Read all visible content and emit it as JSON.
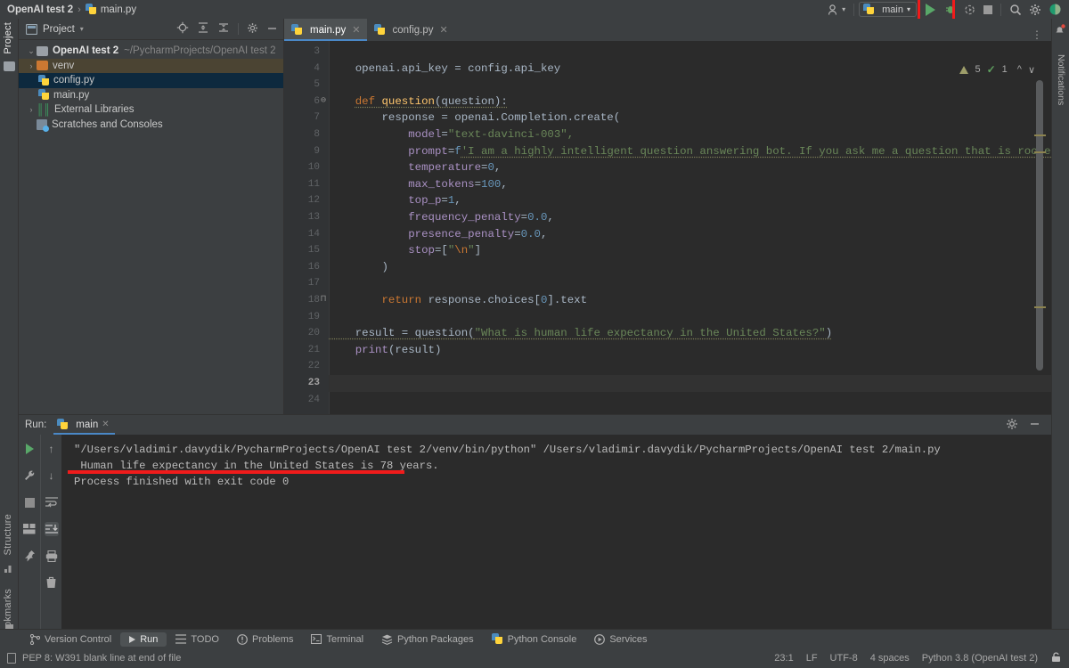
{
  "titlebar": {
    "project_name": "OpenAI test 2",
    "separator": "›",
    "file_name": "main.py"
  },
  "toolbar": {
    "run_config": "main",
    "run_label": "Run",
    "debug_label": "Debug",
    "coverage_label": "Run with Coverage",
    "stop_label": "Stop",
    "search_label": "Search Everywhere",
    "settings_label": "Settings",
    "account_label": "Account",
    "highlight_color": "#f01b1b",
    "run_icon_color": "#59a869"
  },
  "left_strip": {
    "project_tab": "Project",
    "structure_tab": "Structure",
    "bookmarks_tab": "Bookmarks"
  },
  "right_strip": {
    "notifications_tab": "Notifications"
  },
  "project_panel": {
    "title": "Project",
    "tree": [
      {
        "label": "OpenAI test 2",
        "path": "~/PycharmProjects/OpenAI test 2",
        "indent": 0,
        "arrow": "⌄",
        "icon": "folder",
        "bold": true,
        "state": "normal"
      },
      {
        "label": "venv",
        "path": "",
        "indent": 1,
        "arrow": "›",
        "icon": "folder-orange",
        "bold": false,
        "state": "venv"
      },
      {
        "label": "config.py",
        "path": "",
        "indent": 2,
        "arrow": "",
        "icon": "python-file",
        "bold": false,
        "state": "selected"
      },
      {
        "label": "main.py",
        "path": "",
        "indent": 2,
        "arrow": "",
        "icon": "python-file",
        "bold": false,
        "state": "normal"
      },
      {
        "label": "External Libraries",
        "path": "",
        "indent": 0,
        "arrow": "›",
        "icon": "library",
        "bold": false,
        "state": "normal"
      },
      {
        "label": "Scratches and Consoles",
        "path": "",
        "indent": 1,
        "arrow": "",
        "icon": "scratch",
        "bold": false,
        "state": "normal"
      }
    ]
  },
  "editor": {
    "tabs": [
      {
        "label": "main.py",
        "active": true
      },
      {
        "label": "config.py",
        "active": false
      }
    ],
    "inspection": {
      "warning_count": "5",
      "check_count": "1"
    },
    "first_visible_line": 3,
    "current_line": 23,
    "lines": [
      {
        "n": 3,
        "tokens": []
      },
      {
        "n": 4,
        "tokens": [
          {
            "t": "    openai.api_key = config.api_key",
            "c": "dflt"
          }
        ]
      },
      {
        "n": 5,
        "tokens": []
      },
      {
        "n": 6,
        "fold": "⊖",
        "tokens": [
          {
            "t": "    ",
            "c": "dflt"
          },
          {
            "t": "def ",
            "c": "kw wavy"
          },
          {
            "t": "question",
            "c": "fn wavy"
          },
          {
            "t": "(question):",
            "c": "dflt wavy"
          }
        ]
      },
      {
        "n": 7,
        "tokens": [
          {
            "t": "        response = openai.Completion.create(",
            "c": "dflt"
          }
        ]
      },
      {
        "n": 8,
        "tokens": [
          {
            "t": "            ",
            "c": "dflt"
          },
          {
            "t": "model",
            "c": "par"
          },
          {
            "t": "=",
            "c": "dflt"
          },
          {
            "t": "\"text-davinci-003\",",
            "c": "str"
          }
        ]
      },
      {
        "n": 9,
        "tokens": [
          {
            "t": "            ",
            "c": "dflt"
          },
          {
            "t": "prompt",
            "c": "par"
          },
          {
            "t": "=",
            "c": "dflt"
          },
          {
            "t": "f",
            "c": "num"
          },
          {
            "t": "'I am a highly intelligent question answering bot. If you ask me a question that is rooted in truth, I wil",
            "c": "str wavy"
          }
        ]
      },
      {
        "n": 10,
        "tokens": [
          {
            "t": "            ",
            "c": "dflt"
          },
          {
            "t": "temperature",
            "c": "par"
          },
          {
            "t": "=",
            "c": "dflt"
          },
          {
            "t": "0",
            "c": "num"
          },
          {
            "t": ",",
            "c": "dflt"
          }
        ]
      },
      {
        "n": 11,
        "tokens": [
          {
            "t": "            ",
            "c": "dflt"
          },
          {
            "t": "max_tokens",
            "c": "par"
          },
          {
            "t": "=",
            "c": "dflt"
          },
          {
            "t": "100",
            "c": "num"
          },
          {
            "t": ",",
            "c": "dflt"
          }
        ]
      },
      {
        "n": 12,
        "tokens": [
          {
            "t": "            ",
            "c": "dflt"
          },
          {
            "t": "top_p",
            "c": "par"
          },
          {
            "t": "=",
            "c": "dflt"
          },
          {
            "t": "1",
            "c": "num"
          },
          {
            "t": ",",
            "c": "dflt"
          }
        ]
      },
      {
        "n": 13,
        "tokens": [
          {
            "t": "            ",
            "c": "dflt"
          },
          {
            "t": "frequency_penalty",
            "c": "par"
          },
          {
            "t": "=",
            "c": "dflt"
          },
          {
            "t": "0.0",
            "c": "num"
          },
          {
            "t": ",",
            "c": "dflt"
          }
        ]
      },
      {
        "n": 14,
        "tokens": [
          {
            "t": "            ",
            "c": "dflt"
          },
          {
            "t": "presence_penalty",
            "c": "par"
          },
          {
            "t": "=",
            "c": "dflt"
          },
          {
            "t": "0.0",
            "c": "num"
          },
          {
            "t": ",",
            "c": "dflt"
          }
        ]
      },
      {
        "n": 15,
        "tokens": [
          {
            "t": "            ",
            "c": "dflt"
          },
          {
            "t": "stop",
            "c": "par"
          },
          {
            "t": "=[",
            "c": "dflt"
          },
          {
            "t": "\"",
            "c": "str"
          },
          {
            "t": "\\n",
            "c": "kw"
          },
          {
            "t": "\"",
            "c": "str"
          },
          {
            "t": "]",
            "c": "dflt"
          }
        ]
      },
      {
        "n": 16,
        "tokens": [
          {
            "t": "        )",
            "c": "dflt"
          }
        ]
      },
      {
        "n": 17,
        "tokens": []
      },
      {
        "n": 18,
        "fold": "⊓",
        "tokens": [
          {
            "t": "        ",
            "c": "dflt"
          },
          {
            "t": "return ",
            "c": "kw"
          },
          {
            "t": "response.choices[",
            "c": "dflt"
          },
          {
            "t": "0",
            "c": "num"
          },
          {
            "t": "].text",
            "c": "dflt"
          }
        ]
      },
      {
        "n": 19,
        "tokens": []
      },
      {
        "n": 20,
        "tokens": [
          {
            "t": "    result = ",
            "c": "dflt wavy"
          },
          {
            "t": "question",
            "c": "dflt wavy"
          },
          {
            "t": "(",
            "c": "dflt wavy"
          },
          {
            "t": "\"What is human life expectancy in the United States?\"",
            "c": "str wavy"
          },
          {
            "t": ")",
            "c": "dflt wavy"
          }
        ]
      },
      {
        "n": 21,
        "tokens": [
          {
            "t": "    ",
            "c": "dflt"
          },
          {
            "t": "print",
            "c": "par"
          },
          {
            "t": "(result)",
            "c": "dflt"
          }
        ]
      },
      {
        "n": 22,
        "tokens": []
      },
      {
        "n": 23,
        "tokens": []
      },
      {
        "n": 24,
        "tokens": []
      }
    ]
  },
  "run_panel": {
    "run_label": "Run:",
    "tab_label": "main",
    "console_lines": [
      "\"/Users/vladimir.davydik/PycharmProjects/OpenAI test 2/venv/bin/python\" /Users/vladimir.davydik/PycharmProjects/OpenAI test 2/main.py",
      " Human life expectancy in the United States is 78 years.",
      "",
      "Process finished with exit code 0"
    ],
    "annotation_color": "#f01b1b",
    "side_buttons": [
      "rerun-icon",
      "wrench-icon",
      "stop-icon",
      "layout-icon",
      "pin-icon",
      "scroll-up-icon",
      "scroll-down-icon",
      "soft-wrap-icon",
      "scroll-end-icon",
      "print-icon",
      "trash-icon"
    ]
  },
  "bottom_tabs": [
    {
      "label": "Version Control",
      "icon": "branch-icon",
      "active": false
    },
    {
      "label": "Run",
      "icon": "play-icon",
      "active": true
    },
    {
      "label": "TODO",
      "icon": "list-icon",
      "active": false
    },
    {
      "label": "Problems",
      "icon": "error-icon",
      "active": false
    },
    {
      "label": "Terminal",
      "icon": "terminal-icon",
      "active": false
    },
    {
      "label": "Python Packages",
      "icon": "packages-icon",
      "active": false
    },
    {
      "label": "Python Console",
      "icon": "python-icon",
      "active": false
    },
    {
      "label": "Services",
      "icon": "services-icon",
      "active": false
    }
  ],
  "statusbar": {
    "message": "PEP 8: W391 blank line at end of file",
    "caret": "23:1",
    "line_separator": "LF",
    "encoding": "UTF-8",
    "indent": "4 spaces",
    "interpreter": "Python 3.8 (OpenAI test 2)"
  }
}
